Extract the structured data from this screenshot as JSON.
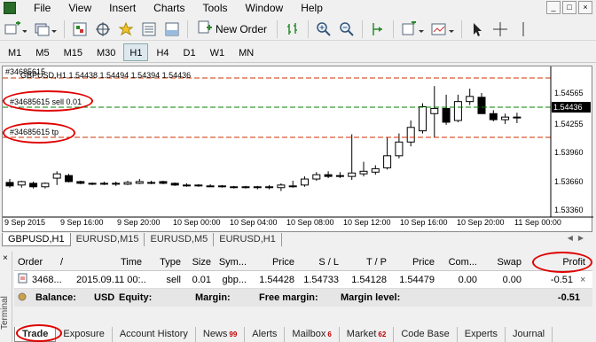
{
  "menu": [
    "File",
    "View",
    "Insert",
    "Charts",
    "Tools",
    "Window",
    "Help"
  ],
  "window_buttons": [
    "_",
    "□",
    "×"
  ],
  "toolbar": {
    "new_order_label": "New Order"
  },
  "timeframes": [
    "M1",
    "M5",
    "M15",
    "M30",
    "H1",
    "H4",
    "D1",
    "W1",
    "MN"
  ],
  "active_timeframe": "H1",
  "chart": {
    "header": "#34685615",
    "symbol_info": "GBPUSD,H1  1.54438 1.54494 1.54394 1.54436",
    "sell_label": "#34685615 sell 0.01",
    "tp_label": "#34685615 tp",
    "current_price": "1.54436",
    "colors": {
      "bull": "#ffffff",
      "bear": "#000000",
      "entry_line": "#008000",
      "tp_line": "#cc3300",
      "price_tag": "#000000",
      "price_tag_text": "#ffffff"
    },
    "price_ticks": [
      "1.54565",
      "1.54436",
      "1.54255",
      "1.53960",
      "1.53660",
      "1.53360"
    ],
    "time_ticks": [
      "9 Sep 2015",
      "9 Sep 16:00",
      "9 Sep 20:00",
      "10 Sep 00:00",
      "10 Sep 04:00",
      "10 Sep 08:00",
      "10 Sep 12:00",
      "10 Sep 16:00",
      "10 Sep 20:00",
      "11 Sep 00:00"
    ]
  },
  "chart_tabs": [
    "GBPUSD,H1",
    "EURUSD,M15",
    "EURUSD,M5",
    "EURUSD,H1"
  ],
  "active_chart_tab": "GBPUSD,H1",
  "terminal": {
    "label": "Terminal",
    "close": "×",
    "headers": [
      "Order",
      "/",
      "Time",
      "Type",
      "Size",
      "Sym...",
      "Price",
      "S / L",
      "T / P",
      "Price",
      "Com...",
      "Swap",
      "Profit"
    ],
    "row": [
      "3468...",
      "2015.09.11 00:...",
      "sell",
      "0.01",
      "gbp...",
      "1.54428",
      "1.54733",
      "1.54128",
      "1.54479",
      "0.00",
      "0.00",
      "-0.51"
    ],
    "balance": {
      "balance_label": "Balance:",
      "currency": "USD",
      "equity_label": "Equity:",
      "margin_label": "Margin:",
      "free_margin_label": "Free margin:",
      "margin_level_label": "Margin level:",
      "profit": "-0.51"
    },
    "tabs": [
      {
        "label": "Trade",
        "badge": ""
      },
      {
        "label": "Exposure",
        "badge": ""
      },
      {
        "label": "Account History",
        "badge": ""
      },
      {
        "label": "News",
        "badge": "99"
      },
      {
        "label": "Alerts",
        "badge": ""
      },
      {
        "label": "Mailbox",
        "badge": "6"
      },
      {
        "label": "Market",
        "badge": "62"
      },
      {
        "label": "Code Base",
        "badge": ""
      },
      {
        "label": "Experts",
        "badge": ""
      },
      {
        "label": "Journal",
        "badge": ""
      }
    ],
    "active_tab": "Trade"
  },
  "annotation_color": "#e00000"
}
